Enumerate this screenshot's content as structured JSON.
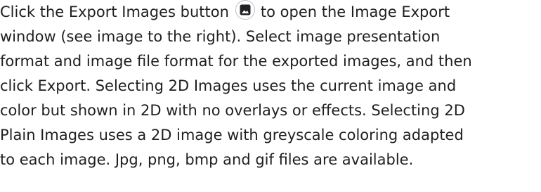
{
  "paragraph": {
    "line1_before_icon": "Click the Export Images button",
    "line1_after_icon": "to open the Image Export",
    "line2": "window (see image to the right). Select image presentation",
    "line3": "format and image file format for the exported images, and then",
    "line4": "click Export. Selecting 2D Images uses the current image and",
    "line5": "color but shown in 2D with no overlays or effects. Selecting 2D",
    "line6": "Plain Images uses a 2D image with greyscale coloring adapted",
    "line7": "to each image. Jpg, png, bmp and gif files are available."
  },
  "icon": {
    "name": "export-images-icon",
    "color": "#202124"
  }
}
